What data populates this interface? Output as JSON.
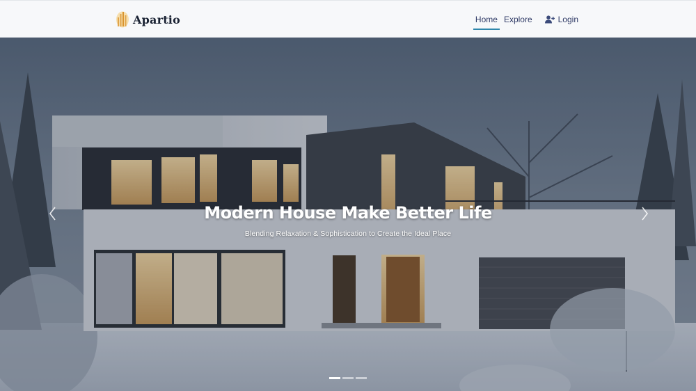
{
  "brand": {
    "name": "Apartio",
    "logo_icon": "building-bars-icon",
    "logo_color": "#e0a34a"
  },
  "nav": {
    "items": [
      {
        "label": "Home",
        "active": true
      },
      {
        "label": "Explore",
        "active": false
      }
    ],
    "login": {
      "label": "Login",
      "icon": "user-plus-icon"
    },
    "active_underline_color": "#2e86ab",
    "link_color": "#2f3a66"
  },
  "hero": {
    "title": "Modern House Make Better Life",
    "subtitle": "Blending Relaxation & Sophistication to Create the Ideal Place",
    "prev_icon": "chevron-left-icon",
    "next_icon": "chevron-right-icon",
    "slides": 3,
    "active_slide": 1
  }
}
